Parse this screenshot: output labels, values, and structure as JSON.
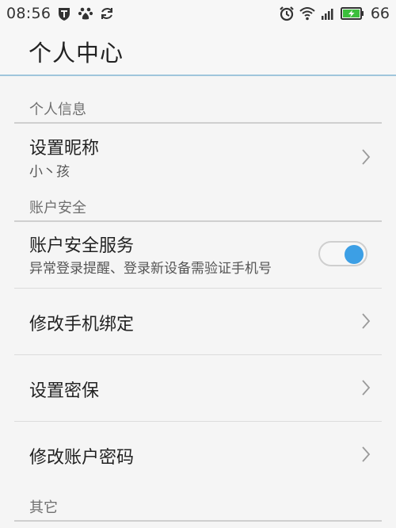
{
  "status_bar": {
    "time": "08:56",
    "left_icons": [
      "shield-t-icon",
      "paw-icon",
      "sync-icon"
    ],
    "right_icons": [
      "alarm-icon",
      "wifi-icon",
      "signal-icon",
      "battery-charging-icon"
    ],
    "battery_level": "66",
    "battery_color": "#3cbf3c"
  },
  "header": {
    "title": "个人中心",
    "accent_line": "#9fc6dc"
  },
  "sections": {
    "personal_info": {
      "label": "个人信息",
      "nickname": {
        "title": "设置昵称",
        "value": "小丶孩"
      }
    },
    "account_security": {
      "label": "账户安全",
      "security_service": {
        "title": "账户安全服务",
        "subtitle": "异常登录提醒、登录新设备需验证手机号",
        "enabled": true,
        "toggle_color": "#3c9fe5"
      },
      "change_phone": {
        "title": "修改手机绑定"
      },
      "set_security": {
        "title": "设置密保"
      },
      "change_password": {
        "title": "修改账户密码"
      }
    },
    "other": {
      "label": "其它"
    }
  }
}
